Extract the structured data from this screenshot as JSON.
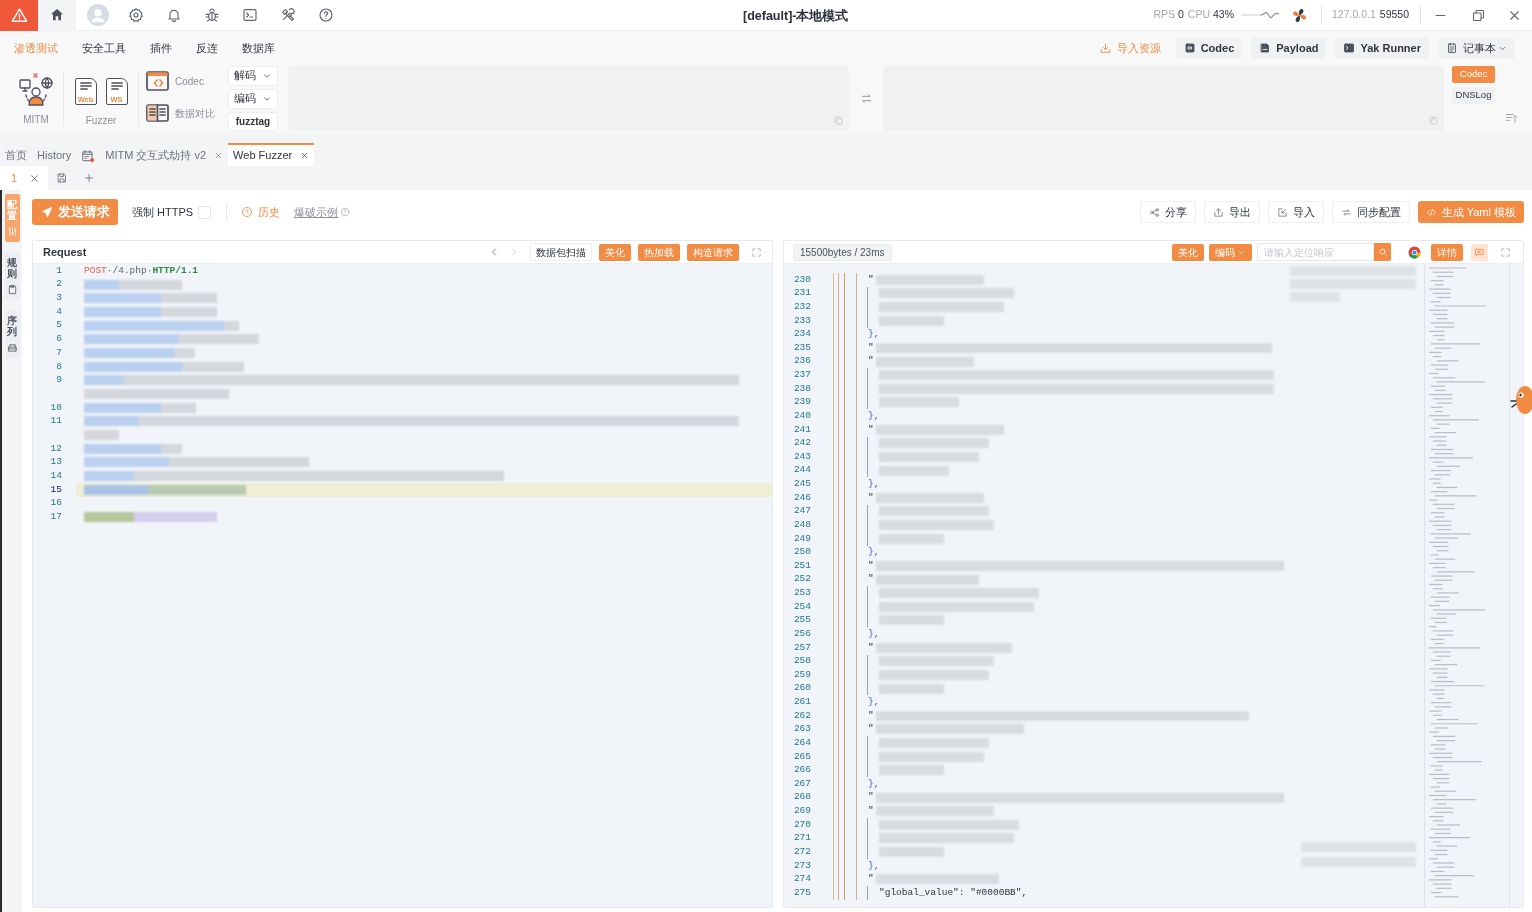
{
  "title_bar": {
    "title": "[default]-本地模式",
    "rps_label": "RPS",
    "rps": "0",
    "cpu_label": "CPU",
    "cpu": "43%",
    "host": "127.0.0.1",
    "port": "59550"
  },
  "menu": {
    "tabs": [
      {
        "label": "渗透测试",
        "selected": true
      },
      {
        "label": "安全工具",
        "selected": false
      },
      {
        "label": "插件",
        "selected": false
      },
      {
        "label": "反连",
        "selected": false
      },
      {
        "label": "数据库",
        "selected": false
      }
    ],
    "actions": [
      {
        "label": "导入资源",
        "kind": "link"
      },
      {
        "label": "Codec",
        "kind": "button"
      },
      {
        "label": "Payload",
        "kind": "button"
      },
      {
        "label": "Yak Runner",
        "kind": "button"
      },
      {
        "label": "记事本",
        "kind": "dropdown"
      }
    ]
  },
  "ribbon": {
    "mitm": "MITM",
    "fuzzer": {
      "label": "Fuzzer",
      "items": [
        "Web",
        "WS"
      ]
    },
    "tools": [
      "Codec",
      "数据对比"
    ],
    "controls": [
      {
        "label": "解码",
        "kind": "dropdown"
      },
      {
        "label": "编码",
        "kind": "dropdown"
      },
      {
        "label": "fuzztag",
        "kind": "button"
      }
    ],
    "side_buttons": [
      {
        "label": "Codec",
        "selected": true
      },
      {
        "label": "DNSLog",
        "selected": false
      }
    ]
  },
  "page_tabs": [
    {
      "kind": "text",
      "label": "首页",
      "selected": false,
      "closable": false
    },
    {
      "kind": "text",
      "label": "History",
      "selected": false,
      "closable": false
    },
    {
      "kind": "icon",
      "selected": false,
      "closable": false
    },
    {
      "kind": "text",
      "label": "MITM 交互式劫持 v2",
      "selected": false,
      "closable": true
    },
    {
      "kind": "text",
      "label": "Web Fuzzer",
      "selected": true,
      "closable": true
    }
  ],
  "sub_tabs": [
    {
      "label": "1",
      "selected": true
    }
  ],
  "side_tabs": [
    {
      "label": "配置",
      "selected": true
    },
    {
      "label": "规则",
      "selected": false
    },
    {
      "label": "序列",
      "selected": false
    }
  ],
  "action_bar": {
    "send": "发送请求",
    "force_https": {
      "label": "强制 HTTPS",
      "checked": false
    },
    "history": "历史",
    "example": "爆破示例",
    "buttons": [
      {
        "label": "分享",
        "kind": "default"
      },
      {
        "label": "导出",
        "kind": "default"
      },
      {
        "label": "导入",
        "kind": "default"
      },
      {
        "label": "同步配置",
        "kind": "default"
      },
      {
        "label": "生成 Yaml 模板",
        "kind": "primary"
      }
    ]
  },
  "request": {
    "title": "Request",
    "nav": [
      {
        "kind": "prev",
        "disabled": false
      },
      {
        "kind": "next",
        "disabled": true
      }
    ],
    "buttons": [
      {
        "label": "数据包扫描",
        "kind": "default"
      },
      {
        "label": "美化",
        "kind": "primary"
      },
      {
        "label": "热加载",
        "kind": "primary"
      },
      {
        "label": "构造请求",
        "kind": "primary"
      }
    ],
    "lines": [
      {
        "number": "1",
        "kind": "text",
        "highlighted": false,
        "segments": [
          {
            "text": "POST",
            "kind": "method"
          },
          {
            "text": "·/4.php·",
            "kind": "plain"
          },
          {
            "text": "HTTP/1.1",
            "kind": "version"
          }
        ]
      },
      {
        "number": "2",
        "kind": "redacted",
        "highlighted": false
      },
      {
        "number": "3",
        "kind": "redacted",
        "highlighted": false
      },
      {
        "number": "4",
        "kind": "redacted",
        "highlighted": false
      },
      {
        "number": "5",
        "kind": "redacted",
        "highlighted": false
      },
      {
        "number": "6",
        "kind": "redacted",
        "highlighted": false
      },
      {
        "number": "7",
        "kind": "redacted",
        "highlighted": false
      },
      {
        "number": "8",
        "kind": "redacted",
        "highlighted": false
      },
      {
        "number": "9",
        "kind": "redacted",
        "highlighted": false
      },
      {
        "kind": "wrap",
        "highlighted": false
      },
      {
        "number": "10",
        "kind": "redacted",
        "highlighted": false
      },
      {
        "number": "11",
        "kind": "redacted",
        "highlighted": false
      },
      {
        "kind": "wrap",
        "highlighted": false
      },
      {
        "number": "12",
        "kind": "redacted",
        "highlighted": false
      },
      {
        "number": "13",
        "kind": "redacted",
        "highlighted": false
      },
      {
        "number": "14",
        "kind": "redacted",
        "highlighted": false
      },
      {
        "number": "15",
        "kind": "redacted",
        "highlighted": true
      },
      {
        "number": "16",
        "kind": "empty",
        "highlighted": false
      },
      {
        "number": "17",
        "kind": "redacted",
        "highlighted": false
      }
    ]
  },
  "response": {
    "stats": "15500bytes / 23ms",
    "buttons": [
      {
        "label": "美化",
        "kind": "primary"
      },
      {
        "label": "编码",
        "kind": "dropdown"
      }
    ],
    "search": {
      "placeholder": "请输入定位响应"
    },
    "detail": "详情",
    "lines": [
      {
        "number": "230",
        "kind": "key",
        "text": "\""
      },
      {
        "number": "231",
        "kind": "value"
      },
      {
        "number": "232",
        "kind": "value"
      },
      {
        "number": "233",
        "kind": "value"
      },
      {
        "number": "234",
        "kind": "close",
        "text": "},"
      },
      {
        "number": "235",
        "kind": "key",
        "text": "\""
      },
      {
        "number": "236",
        "kind": "key",
        "text": "\""
      },
      {
        "number": "237",
        "kind": "value"
      },
      {
        "number": "238",
        "kind": "value"
      },
      {
        "number": "239",
        "kind": "value"
      },
      {
        "number": "240",
        "kind": "close",
        "text": "},"
      },
      {
        "number": "241",
        "kind": "key",
        "text": "\""
      },
      {
        "number": "242",
        "kind": "value"
      },
      {
        "number": "243",
        "kind": "value"
      },
      {
        "number": "244",
        "kind": "value"
      },
      {
        "number": "245",
        "kind": "close",
        "text": "},"
      },
      {
        "number": "246",
        "kind": "key",
        "text": "\""
      },
      {
        "number": "247",
        "kind": "value"
      },
      {
        "number": "248",
        "kind": "value"
      },
      {
        "number": "249",
        "kind": "value"
      },
      {
        "number": "250",
        "kind": "close",
        "text": "},"
      },
      {
        "number": "251",
        "kind": "key",
        "text": "\""
      },
      {
        "number": "252",
        "kind": "key",
        "text": "\""
      },
      {
        "number": "253",
        "kind": "value"
      },
      {
        "number": "254",
        "kind": "value"
      },
      {
        "number": "255",
        "kind": "value"
      },
      {
        "number": "256",
        "kind": "close",
        "text": "},"
      },
      {
        "number": "257",
        "kind": "key",
        "text": "\""
      },
      {
        "number": "258",
        "kind": "value"
      },
      {
        "number": "259",
        "kind": "value"
      },
      {
        "number": "260",
        "kind": "value"
      },
      {
        "number": "261",
        "kind": "close",
        "text": "},"
      },
      {
        "number": "262",
        "kind": "key",
        "text": "\""
      },
      {
        "number": "263",
        "kind": "key",
        "text": "\""
      },
      {
        "number": "264",
        "kind": "value"
      },
      {
        "number": "265",
        "kind": "value"
      },
      {
        "number": "266",
        "kind": "value"
      },
      {
        "number": "267",
        "kind": "close",
        "text": "},"
      },
      {
        "number": "268",
        "kind": "key",
        "text": "\""
      },
      {
        "number": "269",
        "kind": "key",
        "text": "\""
      },
      {
        "number": "270",
        "kind": "value"
      },
      {
        "number": "271",
        "kind": "value"
      },
      {
        "number": "272",
        "kind": "value"
      },
      {
        "number": "273",
        "kind": "close",
        "text": "},"
      },
      {
        "number": "274",
        "kind": "key",
        "text": "\""
      },
      {
        "number": "275",
        "kind": "text",
        "text": "\"global_value\": \"#0000BB\","
      }
    ]
  }
}
